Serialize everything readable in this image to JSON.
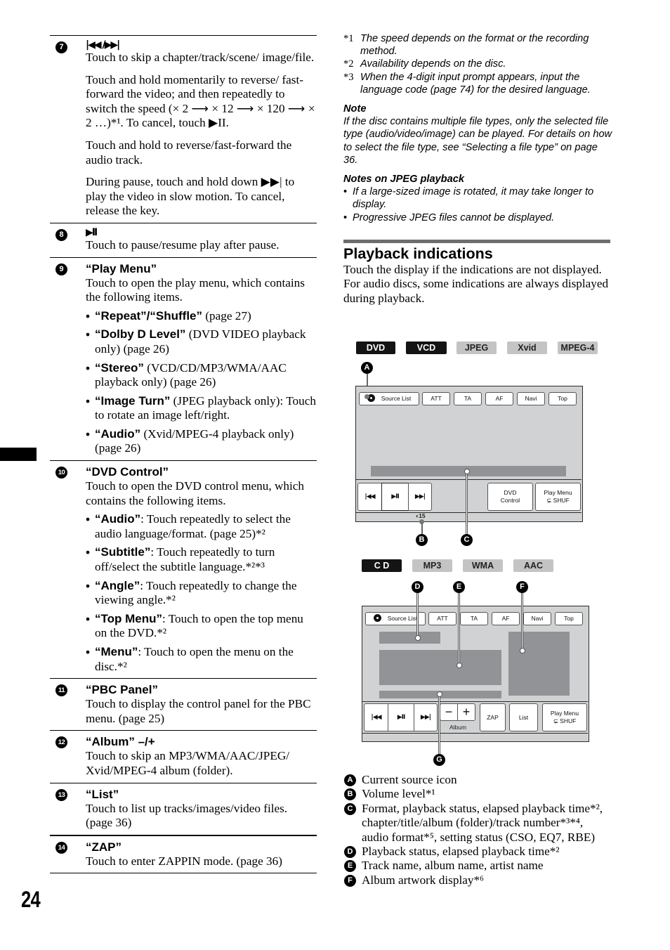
{
  "page_number": "24",
  "left_entries": [
    {
      "num": "7",
      "head_glyph": "|◀◀ /▶▶|",
      "paras": [
        "Touch to skip a chapter/track/scene/ image/file.",
        "Touch and hold momentarily to reverse/ fast-forward the video; and then repeatedly to switch the speed (× 2 ⟶ × 12 ⟶ × 120 ⟶ × 2 …)*¹. To cancel, touch ▶II.",
        "Touch and hold to reverse/fast-forward the audio track.",
        "During pause, touch and hold down ▶▶| to play the video in slow motion. To cancel, release the key."
      ]
    },
    {
      "num": "8",
      "head_glyph": "▶II",
      "paras": [
        "Touch to pause/resume play after pause."
      ]
    },
    {
      "num": "9",
      "head": "“Play Menu”",
      "paras": [
        "Touch to open the play menu, which contains the following items."
      ],
      "bullets": [
        {
          "b": "“Repeat”/“Shuffle”",
          "t": " (page 27)"
        },
        {
          "b": "“Dolby D Level”",
          "t": " (DVD VIDEO playback only) (page 26)"
        },
        {
          "b": "“Stereo”",
          "t": " (VCD/CD/MP3/WMA/AAC playback only) (page 26)"
        },
        {
          "b": "“Image Turn”",
          "t": " (JPEG playback only): Touch to rotate an image left/right."
        },
        {
          "b": "“Audio”",
          "t": " (Xvid/MPEG-4 playback only) (page 26)"
        }
      ]
    },
    {
      "num": "10",
      "head": "“DVD Control”",
      "paras": [
        "Touch to open the DVD control menu, which contains the following items."
      ],
      "bullets": [
        {
          "b": "“Audio”",
          "t": ": Touch repeatedly to select the audio language/format. (page 25)*²"
        },
        {
          "b": "“Subtitle”",
          "t": ": Touch repeatedly to turn off/select the subtitle language.*²*³"
        },
        {
          "b": "“Angle”",
          "t": ": Touch repeatedly to change the viewing angle.*²"
        },
        {
          "b": "“Top Menu”",
          "t": ": Touch to open the top menu on the DVD.*²"
        },
        {
          "b": "“Menu”",
          "t": ": Touch to open the menu on the disc.*²"
        }
      ]
    },
    {
      "num": "11",
      "head": "“PBC Panel”",
      "paras": [
        "Touch to display the control panel for the PBC menu. (page 25)"
      ]
    },
    {
      "num": "12",
      "head": "“Album” –/+",
      "paras": [
        "Touch to skip an MP3/WMA/AAC/JPEG/ Xvid/MPEG-4 album (folder)."
      ]
    },
    {
      "num": "13",
      "head": "“List”",
      "paras": [
        "Touch to list up tracks/images/video files. (page 36)"
      ]
    },
    {
      "num": "14",
      "head": "“ZAP”",
      "paras": [
        "Touch to enter ZAPPIN mode. (page 36)"
      ]
    }
  ],
  "footnotes": [
    {
      "mark": "*1",
      "text": "The speed depends on the format or the recording method."
    },
    {
      "mark": "*2",
      "text": "Availability depends on the disc."
    },
    {
      "mark": "*3",
      "text": "When the 4-digit input prompt appears, input the language code (page 74) for the desired language."
    }
  ],
  "note": {
    "title": "Note",
    "text": "If the disc contains multiple file types, only the selected file type (audio/video/image) can be played. For details on how to select the file type, see “Selecting a file type” on page 36."
  },
  "jpeg_notes": {
    "title": "Notes on JPEG playback",
    "items": [
      "If a large-sized image is rotated, it may take longer to display.",
      "Progressive JPEG files cannot be displayed."
    ]
  },
  "section": {
    "title": "Playback indications",
    "paras": [
      "Touch the display if the indications are not displayed.",
      "For audio discs, some indications are always displayed during playback."
    ]
  },
  "video_formats": [
    {
      "label": "DVD",
      "active": true
    },
    {
      "label": "VCD",
      "active": true
    },
    {
      "label": "JPEG",
      "active": false
    },
    {
      "label": "Xvid",
      "active": false
    },
    {
      "label": "MPEG-4",
      "active": false
    }
  ],
  "audio_formats": [
    {
      "label": "C D",
      "active": true
    },
    {
      "label": "MP3",
      "active": false
    },
    {
      "label": "WMA",
      "active": false
    },
    {
      "label": "AAC",
      "active": false
    }
  ],
  "screen_top_buttons": [
    "Source List",
    "ATT",
    "TA",
    "AF",
    "Navi",
    "Top"
  ],
  "screen1": {
    "prev": "|◀◀",
    "play": "▶II",
    "next": "▶▶|",
    "dvd_control": [
      "DVD",
      "Control"
    ],
    "play_menu": [
      "Play Menu",
      "⊊ SHUF"
    ],
    "volume": "15"
  },
  "screen2": {
    "prev": "|◀◀",
    "play": "▶II",
    "next": "▶▶|",
    "album_minus": "−",
    "album_plus": "+",
    "album_label": "Album",
    "zap": "ZAP",
    "list": "List",
    "play_menu": [
      "Play Menu",
      "⊊ SHUF"
    ]
  },
  "callouts": [
    "A",
    "B",
    "C",
    "D",
    "E",
    "F",
    "G"
  ],
  "legend": [
    {
      "key": "A",
      "text": "Current source icon"
    },
    {
      "key": "B",
      "text": "Volume level*¹"
    },
    {
      "key": "C",
      "text": "Format, playback status, elapsed playback time*², chapter/title/album (folder)/track number*³*⁴, audio format*⁵, setting status (CSO, EQ7, RBE)"
    },
    {
      "key": "D",
      "text": "Playback status, elapsed playback time*²"
    },
    {
      "key": "E",
      "text": "Track name, album name, artist name"
    },
    {
      "key": "F",
      "text": "Album artwork display*⁶"
    }
  ]
}
